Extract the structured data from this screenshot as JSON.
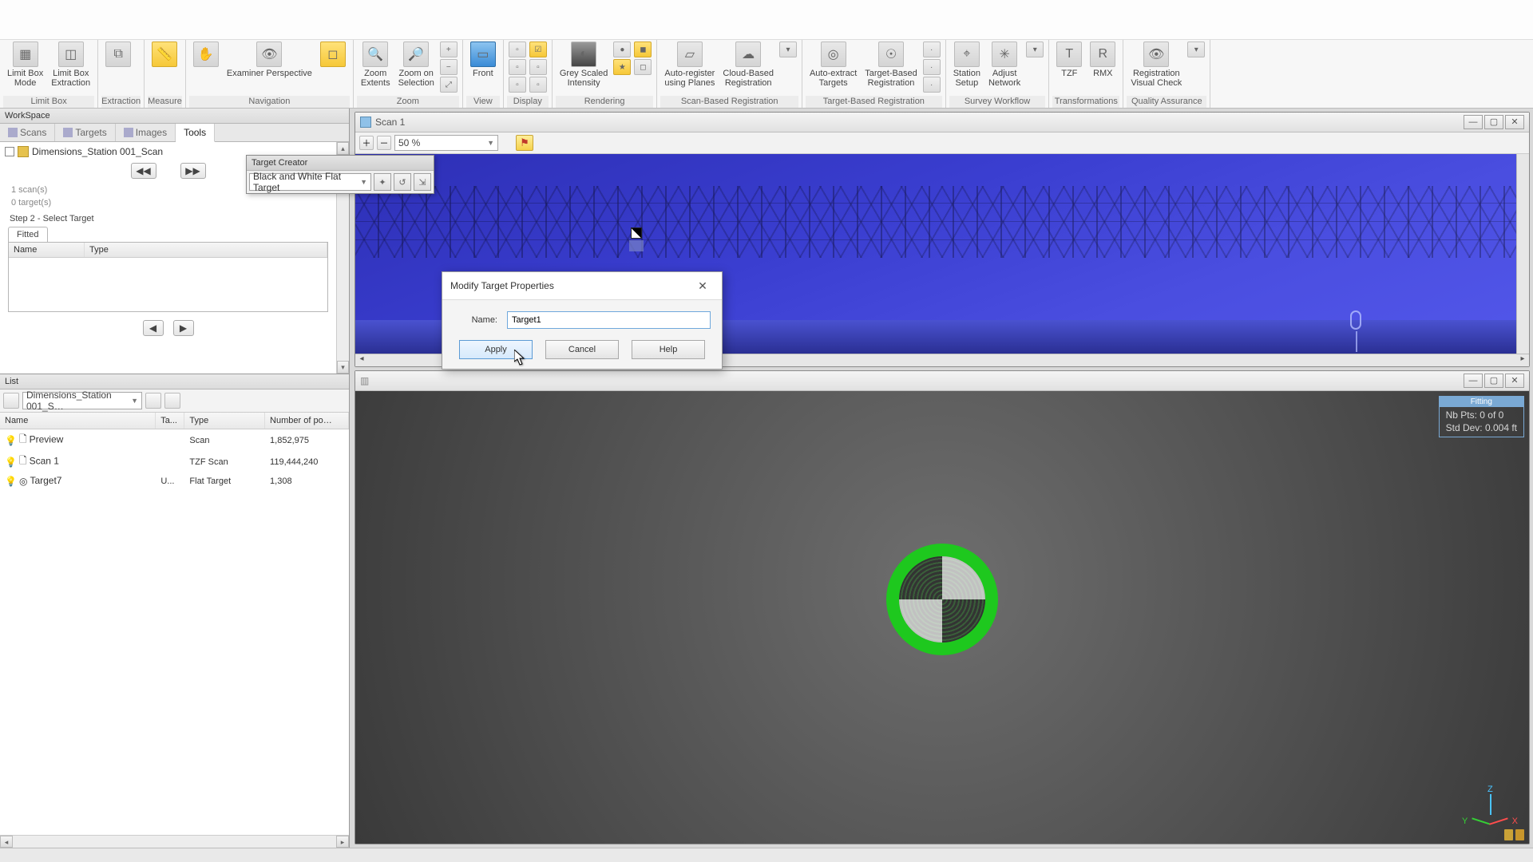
{
  "ribbon": {
    "groups": {
      "limitbox": {
        "label": "Limit Box",
        "btns": [
          "Limit Box\nMode",
          "Limit Box\nExtraction"
        ]
      },
      "extraction": {
        "label": "Extraction"
      },
      "measure": {
        "label": "Measure"
      },
      "navigation": {
        "label": "Navigation",
        "btns": [
          "",
          "Examiner Perspective"
        ]
      },
      "zoom": {
        "label": "Zoom",
        "btns": [
          "Zoom\nExtents",
          "Zoom on\nSelection"
        ]
      },
      "view": {
        "label": "View",
        "btns": [
          "Front"
        ]
      },
      "display": {
        "label": "Display"
      },
      "rendering": {
        "label": "Rendering",
        "btns": [
          "Grey Scaled\nIntensity"
        ]
      },
      "scanreg": {
        "label": "Scan-Based Registration",
        "btns": [
          "Auto-register\nusing Planes",
          "Cloud-Based\nRegistration"
        ]
      },
      "targetreg": {
        "label": "Target-Based Registration",
        "btns": [
          "Auto-extract\nTargets",
          "Target-Based\nRegistration"
        ]
      },
      "survey": {
        "label": "Survey Workflow",
        "btns": [
          "Station\nSetup",
          "Adjust\nNetwork"
        ]
      },
      "transforms": {
        "label": "Transformations",
        "btns": [
          "TZF",
          "RMX"
        ]
      },
      "qa": {
        "label": "Quality Assurance",
        "btns": [
          "Registration\nVisual Check"
        ]
      }
    }
  },
  "workspace": {
    "title": "WorkSpace",
    "tabs": [
      "Scans",
      "Targets",
      "Images",
      "Tools"
    ],
    "active_tab": "Tools",
    "tree_item": "Dimensions_Station 001_Scan",
    "info1": "1 scan(s)",
    "info2": "0 target(s)",
    "step": "Step 2 - Select Target",
    "fitted": "Fitted",
    "cols": {
      "name": "Name",
      "type": "Type"
    }
  },
  "target_creator": {
    "title": "Target Creator",
    "combo": "Black and White Flat Target"
  },
  "list": {
    "title": "List",
    "path": "Dimensions_Station 001_S…",
    "cols": {
      "name": "Name",
      "ta": "Ta...",
      "type": "Type",
      "pts": "Number of po…"
    },
    "rows": [
      {
        "name": "Preview",
        "ta": "",
        "type": "Scan",
        "pts": "1,852,975"
      },
      {
        "name": "Scan 1",
        "ta": "",
        "type": "TZF Scan",
        "pts": "119,444,240"
      },
      {
        "name": "Target7",
        "ta": "U...",
        "type": "Flat Target",
        "pts": "1,308"
      }
    ]
  },
  "scanwin": {
    "title": "Scan 1",
    "zoom": "50 %"
  },
  "fitting": {
    "header": "Fitting",
    "line1": "Nb Pts: 0 of 0",
    "line2": "Std Dev: 0.004 ft",
    "axes": {
      "x": "X",
      "y": "Y",
      "z": "Z"
    }
  },
  "dialog": {
    "title": "Modify Target Properties",
    "name_label": "Name:",
    "name_value": "Target1",
    "apply": "Apply",
    "cancel": "Cancel",
    "help": "Help"
  }
}
